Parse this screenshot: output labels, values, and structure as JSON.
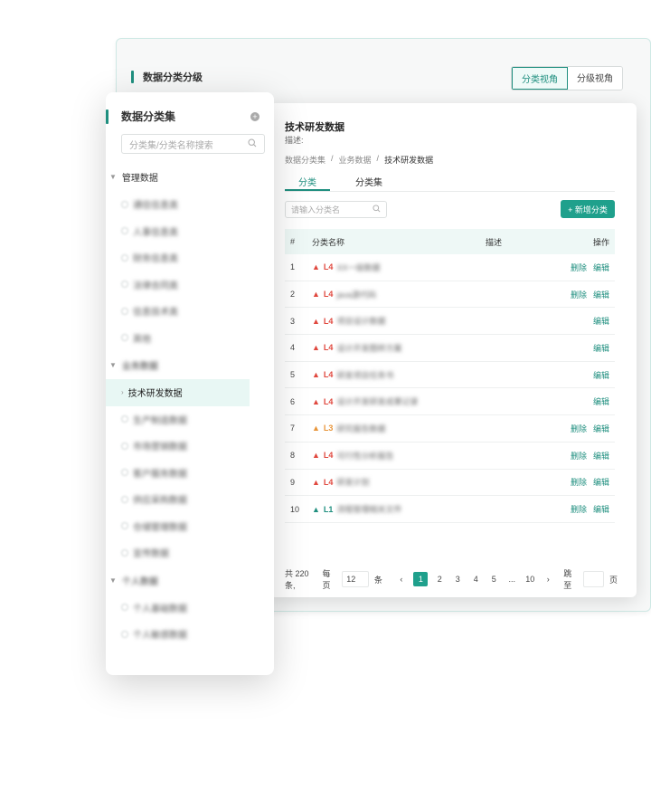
{
  "back_window": {
    "title": "数据分类分级",
    "view_toggle": [
      "分类视角",
      "分级视角"
    ]
  },
  "main": {
    "title": "技术研发数据",
    "description_label": "描述:",
    "breadcrumb": [
      "数据分类集",
      "/",
      "业务数据",
      "/",
      "技术研发数据"
    ],
    "tabs": [
      "分类",
      "分类集"
    ],
    "search_placeholder": "请输入分类名",
    "add_button": "+ 新增分类",
    "table": {
      "headers": {
        "idx": "#",
        "name": "分类名称",
        "desc": "描述",
        "ops": "操作"
      },
      "rows": [
        {
          "idx": "1",
          "level": "L4",
          "level_color": "#e0483e",
          "name": "XX一级数据",
          "ops": [
            "删除",
            "编辑"
          ]
        },
        {
          "idx": "2",
          "level": "L4",
          "level_color": "#e0483e",
          "name": "java源代码",
          "ops": [
            "删除",
            "编辑"
          ]
        },
        {
          "idx": "3",
          "level": "L4",
          "level_color": "#e0483e",
          "name": "项目设计数据",
          "ops": [
            "编辑"
          ]
        },
        {
          "idx": "4",
          "level": "L4",
          "level_color": "#e0483e",
          "name": "设计开发图样方案",
          "ops": [
            "编辑"
          ]
        },
        {
          "idx": "5",
          "level": "L4",
          "level_color": "#e0483e",
          "name": "研发项目任务书",
          "ops": [
            "编辑"
          ]
        },
        {
          "idx": "6",
          "level": "L4",
          "level_color": "#e0483e",
          "name": "设计开发研发成果记录",
          "ops": [
            "编辑"
          ]
        },
        {
          "idx": "7",
          "level": "L3",
          "level_color": "#e8953a",
          "name": "研究报告数据",
          "ops": [
            "删除",
            "编辑"
          ]
        },
        {
          "idx": "8",
          "level": "L4",
          "level_color": "#e0483e",
          "name": "可行性分析报告",
          "ops": [
            "删除",
            "编辑"
          ]
        },
        {
          "idx": "9",
          "level": "L4",
          "level_color": "#e0483e",
          "name": "研发计划",
          "ops": [
            "删除",
            "编辑"
          ]
        },
        {
          "idx": "10",
          "level": "L1",
          "level_color": "#1f8f7f",
          "name": "流程管理相关文件",
          "ops": [
            "删除",
            "编辑"
          ]
        }
      ]
    },
    "pagination": {
      "total_prefix": "共 220 条,",
      "per_page_label": "每页",
      "per_page_value": "12",
      "per_page_suffix": "条",
      "pages": [
        "1",
        "2",
        "3",
        "4",
        "5",
        "...",
        "10"
      ],
      "jump_label": "跳至",
      "jump_suffix": "页"
    }
  },
  "sidebar": {
    "title": "数据分类集",
    "search_placeholder": "分类集/分类名称搜索",
    "groups": [
      {
        "label": "管理数据",
        "blurred": false,
        "items": [
          "通信信息类",
          "人事信息类",
          "财务信息类",
          "法律合同类",
          "信息技术类",
          "其他"
        ]
      },
      {
        "label": "业务数据",
        "blurred": true,
        "items": [
          "技术研发数据",
          "生产制造数据",
          "市场营销数据",
          "客户服务数据",
          "供应采购数据",
          "仓储管理数据",
          "宣传数据"
        ]
      },
      {
        "label": "个人数据",
        "blurred": true,
        "items": [
          "个人基础数据",
          "个人敏感数据"
        ]
      }
    ],
    "active_item": "技术研发数据"
  },
  "colors": {
    "accent": "#1f8f7f",
    "button": "#1fa08c",
    "l4": "#e0483e",
    "l3": "#e8953a",
    "l1": "#1f8f7f"
  }
}
